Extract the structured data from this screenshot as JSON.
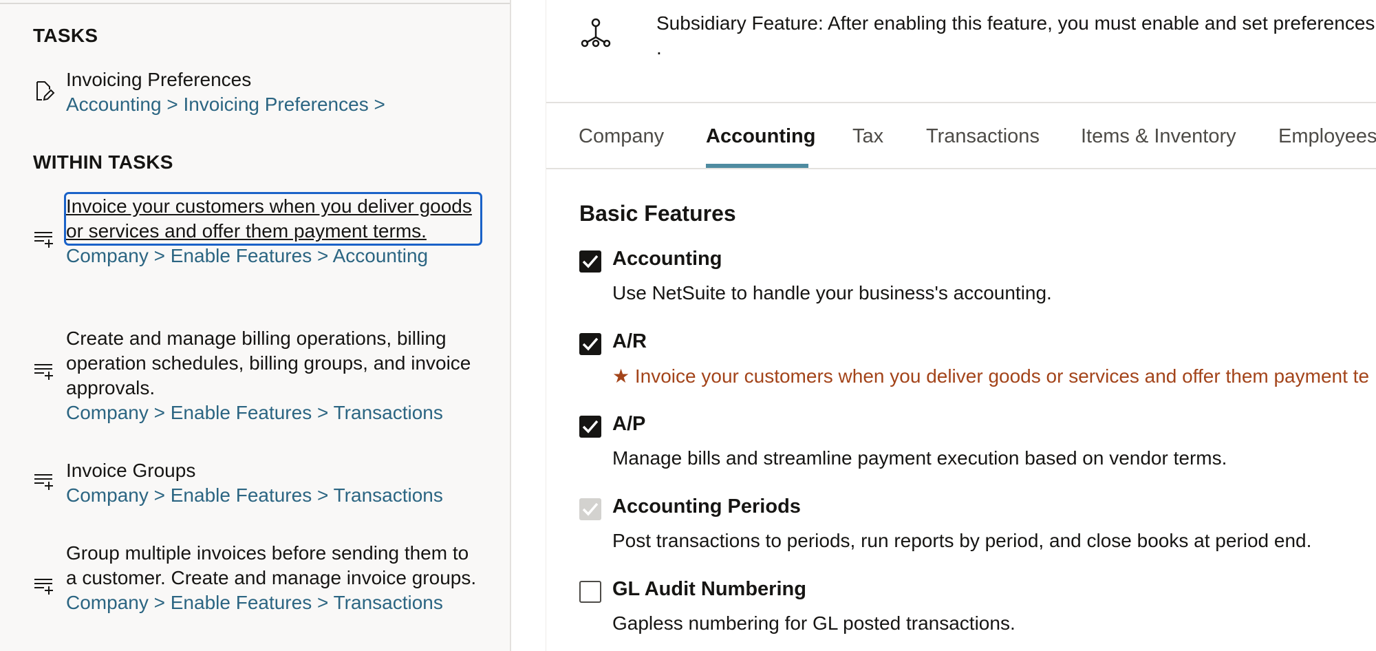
{
  "left": {
    "tasks_heading": "TASKS",
    "within_tasks_heading": "WITHIN TASKS",
    "tasks": [
      {
        "title": "Invoicing Preferences",
        "path": "Accounting > Invoicing Preferences >",
        "icon": "edit-document-icon"
      }
    ],
    "within_tasks": [
      {
        "title": "Invoice your customers when you deliver goods or services and offer them payment terms.",
        "path": "Company > Enable Features > Accounting",
        "icon": "list-add-icon"
      },
      {
        "title": "Create and manage billing operations, billing operation schedules, billing groups, and invoice approvals.",
        "path": "Company > Enable Features > Transactions",
        "icon": "list-add-icon"
      },
      {
        "title": "Invoice Groups",
        "path": "Company > Enable Features > Transactions",
        "icon": "list-add-icon"
      },
      {
        "title": "Group multiple invoices before sending them to a customer. Create and manage invoice groups.",
        "path": "Company > Enable Features > Transactions",
        "icon": "list-add-icon"
      }
    ]
  },
  "right": {
    "notice": {
      "icon": "subsidiary-hierarchy-icon",
      "text": "Subsidiary Feature: After enabling this feature, you must enable and set preferences for",
      "text_line2": "."
    },
    "tabs": [
      {
        "label": "Company",
        "active": false
      },
      {
        "label": "Accounting",
        "active": true
      },
      {
        "label": "Tax",
        "active": false
      },
      {
        "label": "Transactions",
        "active": false
      },
      {
        "label": "Items & Inventory",
        "active": false
      },
      {
        "label": "Employees",
        "active": false
      }
    ],
    "section_title": "Basic Features",
    "features": [
      {
        "label": "Accounting",
        "description": "Use NetSuite to handle your business's accounting.",
        "state": "checked",
        "highlight": false
      },
      {
        "label": "A/R",
        "description": "★ Invoice your customers when you deliver goods or services and offer them payment te",
        "state": "checked",
        "highlight": true
      },
      {
        "label": "A/P",
        "description": "Manage bills and streamline payment execution based on vendor terms.",
        "state": "checked",
        "highlight": false
      },
      {
        "label": "Accounting Periods",
        "description": "Post transactions to periods, run reports by period, and close books at period end.",
        "state": "disabled-checked",
        "highlight": false
      },
      {
        "label": "GL Audit Numbering",
        "description": "Gapless numbering for GL posted transactions.",
        "state": "unchecked",
        "highlight": false
      }
    ]
  },
  "colors": {
    "link_path": "#2b6582",
    "focus_outline": "#1a62c8",
    "tab_underline": "#4e8ba0",
    "highlight_text": "#a3441a",
    "panel_bg": "#f9f8f7"
  }
}
